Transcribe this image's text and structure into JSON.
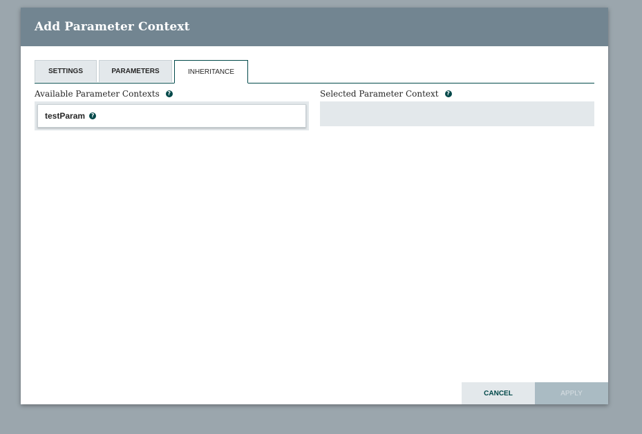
{
  "dialog": {
    "title": "Add Parameter Context"
  },
  "tabs": [
    {
      "label": "SETTINGS",
      "active": false
    },
    {
      "label": "PARAMETERS",
      "active": false
    },
    {
      "label": "INHERITANCE",
      "active": true
    }
  ],
  "available": {
    "label": "Available Parameter Contexts",
    "items": [
      {
        "name": "testParam"
      }
    ]
  },
  "selected": {
    "label": "Selected Parameter Context",
    "items": []
  },
  "footer": {
    "cancel_label": "CANCEL",
    "apply_label": "APPLY"
  },
  "icons": {
    "help": "question-circle-icon"
  },
  "colors": {
    "header_bg": "#728591",
    "accent": "#004849",
    "panel_bg": "#e3e8eb",
    "apply_disabled_bg": "#aabbc3"
  }
}
